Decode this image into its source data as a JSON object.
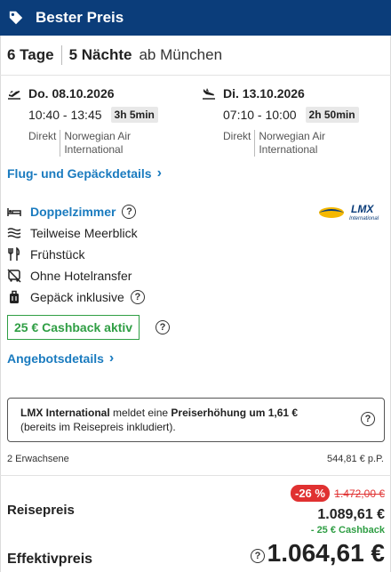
{
  "header": {
    "title": "Bester Preis",
    "icon": "price-tag-icon",
    "bg": "#0b3d7a"
  },
  "duration": {
    "days": "6 Tage",
    "nights": "5 Nächte",
    "from": "ab München"
  },
  "outbound": {
    "icon": "plane-departure-icon",
    "date": "Do. 08.10.2026",
    "times": "10:40 - 13:45",
    "duration": "3h 5min",
    "direct": "Direkt",
    "airline": "Norwegian Air International"
  },
  "return": {
    "icon": "plane-arrival-icon",
    "date": "Di. 13.10.2026",
    "times": "07:10 - 10:00",
    "duration": "2h 50min",
    "direct": "Direkt",
    "airline": "Norwegian Air International"
  },
  "links": {
    "flight_details": "Flug- und Gepäckdetails",
    "offer_details": "Angebotsdetails"
  },
  "hotel": {
    "room": "Doppelzimmer",
    "view": "Teilweise Meerblick",
    "board": "Frühstück",
    "transfer": "Ohne Hotelransfer",
    "luggage": "Gepäck inklusive"
  },
  "operator_logo": {
    "text": "LMX",
    "subtext": "International"
  },
  "cashback_badge": "25 € Cashback aktiv",
  "notice": {
    "operator": "LMX International",
    "text_mid": " meldet eine ",
    "highlight": "Preiserhöhung um 1,61 €",
    "text_end": "(bereits im Reisepreis inkludiert)."
  },
  "pricing": {
    "travellers": "2 Erwachsene",
    "per_person": "544,81 € p.P.",
    "label": "Reisepreis",
    "discount": "-26 %",
    "old_price": "1.472,00 €",
    "new_price": "1.089,61 €",
    "cashback": "- 25 € Cashback",
    "effective_label": "Effektivpreis",
    "effective_price": "1.064,61 €"
  },
  "colors": {
    "accent": "#1a7bbf",
    "green": "#2f9e44",
    "red": "#e03131"
  }
}
